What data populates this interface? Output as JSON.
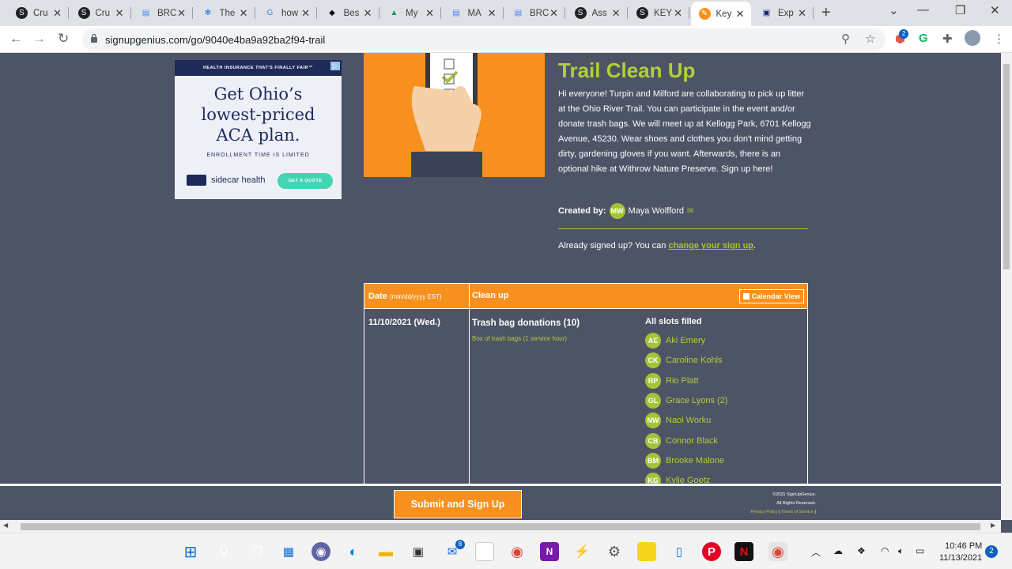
{
  "browser": {
    "tabs": [
      {
        "label": "Cru",
        "icon": "signup-genius-icon"
      },
      {
        "label": "Cru",
        "icon": "signup-genius-icon"
      },
      {
        "label": "BRC",
        "icon": "google-docs-icon"
      },
      {
        "label": "The",
        "icon": "snowflake-icon"
      },
      {
        "label": "how",
        "icon": "google-icon"
      },
      {
        "label": "Bes",
        "icon": "graduation-cap-icon"
      },
      {
        "label": "My",
        "icon": "google-drive-icon"
      },
      {
        "label": "MA",
        "icon": "google-docs-icon"
      },
      {
        "label": "BRC",
        "icon": "google-docs-icon"
      },
      {
        "label": "Ass",
        "icon": "signup-genius-icon"
      },
      {
        "label": "KEY",
        "icon": "signup-genius-icon"
      },
      {
        "label": "Key",
        "icon": "pencil-icon"
      },
      {
        "label": "Exp",
        "icon": "ticket-icon"
      }
    ],
    "active_tab_index": 11,
    "url": "signupgenius.com/go/9040e4ba9a92ba2f94-trail"
  },
  "ad": {
    "top_line": "HEALTH INSURANCE THAT'S FINALLY FAIR™",
    "headline_1": "Get Ohio’s",
    "headline_2": "lowest-priced",
    "headline_3": "ACA plan.",
    "enroll": "ENROLLMENT TIME IS LIMITED",
    "brand": "sidecar health",
    "cta": "GET A QUOTE",
    "adchoice": "▷"
  },
  "event": {
    "title": "Trail Clean Up",
    "description": "Hi everyone! Turpin and Milford are collaborating to pick up litter at the Ohio River Trail. You can participate in the event and/or donate trash bags. We will meet up at Kellogg Park, 6701 Kellogg Avenue, 45230. Wear shoes and clothes you don't mind getting dirty, gardening gloves if you want. Afterwards, there is an optional hike at Withrow Nature Preserve. Sign up here!",
    "created_by_label": "Created by:",
    "creator_initials": "MW",
    "creator_name": "Maya Wolfford",
    "already_text": "Already signed up? You can ",
    "change_link": "change your sign up",
    "already_end": "."
  },
  "table": {
    "date_header": "Date",
    "date_header_note": "(mm/dd/yyyy EST)",
    "activity_header": "Clean up",
    "calendar_button": "Calendar View",
    "row_date": "11/10/2021 (Wed.)",
    "item_name": "Trash bag donations (10)",
    "item_note": "Box of trash bags (1 service hour)",
    "slots_status": "All slots filled",
    "signees": [
      {
        "initials": "AE",
        "name": "Aki Emery"
      },
      {
        "initials": "CK",
        "name": "Caroline Kohls"
      },
      {
        "initials": "RP",
        "name": "Rio Platt"
      },
      {
        "initials": "GL",
        "name": "Grace Lyons (2)"
      },
      {
        "initials": "NW",
        "name": "Naol Worku"
      },
      {
        "initials": "CB",
        "name": "Connor Black"
      },
      {
        "initials": "BM",
        "name": "Brooke Malone"
      },
      {
        "initials": "KG",
        "name": "Kylie Goetz"
      }
    ]
  },
  "footer": {
    "submit": "Submit and Sign Up",
    "copyright": "©2021 SignUpGenius.",
    "rights": "All Rights Reserved.",
    "privacy": "Privacy Policy",
    "terms": "Terms of Service"
  },
  "taskbar": {
    "mail_badge": "8",
    "time": "10:46 PM",
    "date": "11/13/2021",
    "notifications": "2",
    "ext_badge": "2"
  },
  "colors": {
    "page_bg": "#4d5466",
    "orange": "#f7901e",
    "green": "#a5c337"
  }
}
